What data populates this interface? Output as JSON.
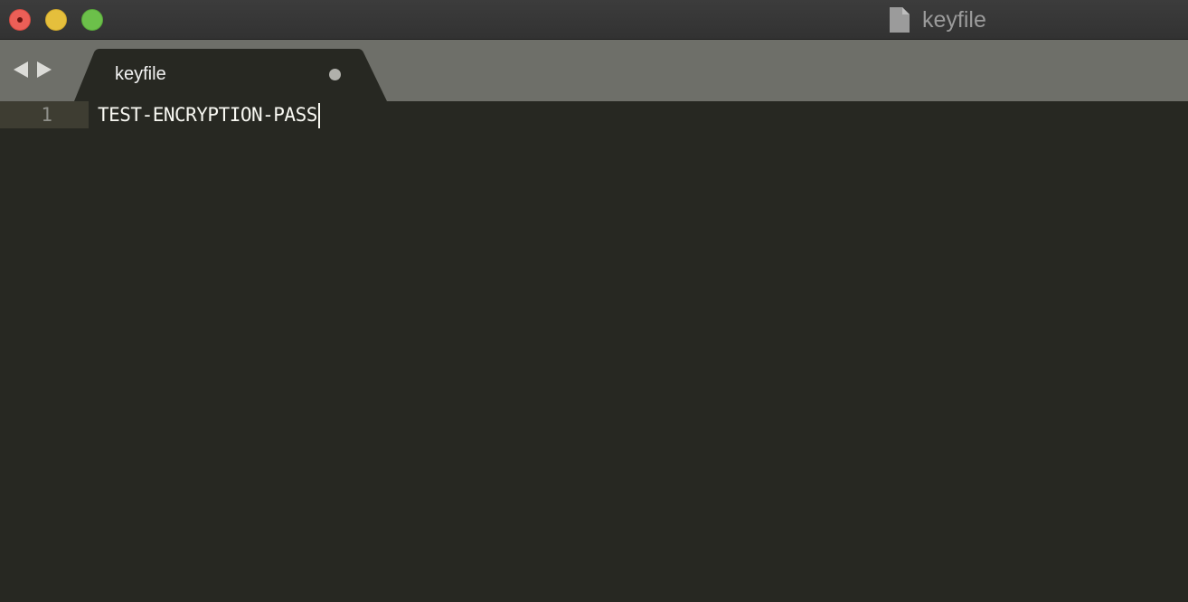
{
  "window": {
    "title": "keyfile",
    "title_icon": "document-icon"
  },
  "tabs": [
    {
      "label": "keyfile",
      "dirty": true
    }
  ],
  "editor": {
    "lines": [
      {
        "number": "1",
        "text": "TEST-ENCRYPTION-PASS"
      }
    ]
  },
  "colors": {
    "editor_bg": "#272822",
    "tabbar_bg": "#6e6f69",
    "text": "#f8f8f2",
    "gutter_text": "#8f908a",
    "active_line_gutter": "#3e3d32",
    "close": "#ec5f57",
    "minimize": "#e5bf3c",
    "maximize": "#6cc04a"
  }
}
